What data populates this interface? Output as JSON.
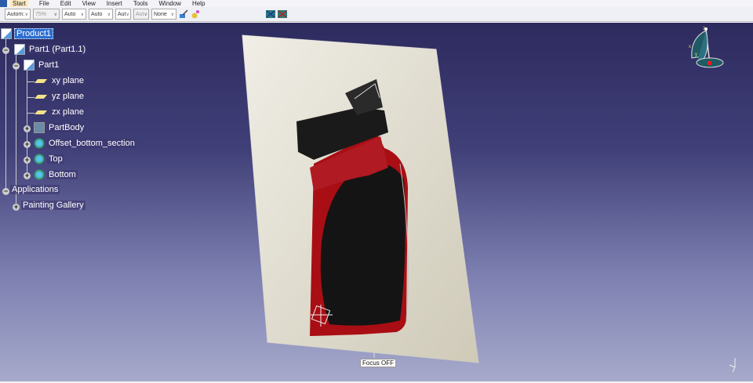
{
  "menu": [
    "Start",
    "File",
    "Edit",
    "View",
    "Insert",
    "Tools",
    "Window",
    "Help"
  ],
  "toolbar": {
    "selects": [
      "Autom:",
      "75%",
      "Auto",
      "Auto",
      "Aut",
      "Aut",
      "None"
    ]
  },
  "tree": {
    "root": "Product1",
    "part_instance": "Part1 (Part1.1)",
    "part": "Part1",
    "planes": [
      "xy plane",
      "yz plane",
      "zx plane"
    ],
    "bodies": [
      "PartBody",
      "Offset_bottom_section",
      "Top",
      "Bottom"
    ],
    "applications": "Applications",
    "painting": "Painting Gallery"
  },
  "viewer": {
    "focus_label": "Focus OFF",
    "compass_axes": [
      "x",
      "y",
      "z"
    ]
  },
  "colors": {
    "accent": "#2d6fd0",
    "product_red": "#a80e14"
  }
}
